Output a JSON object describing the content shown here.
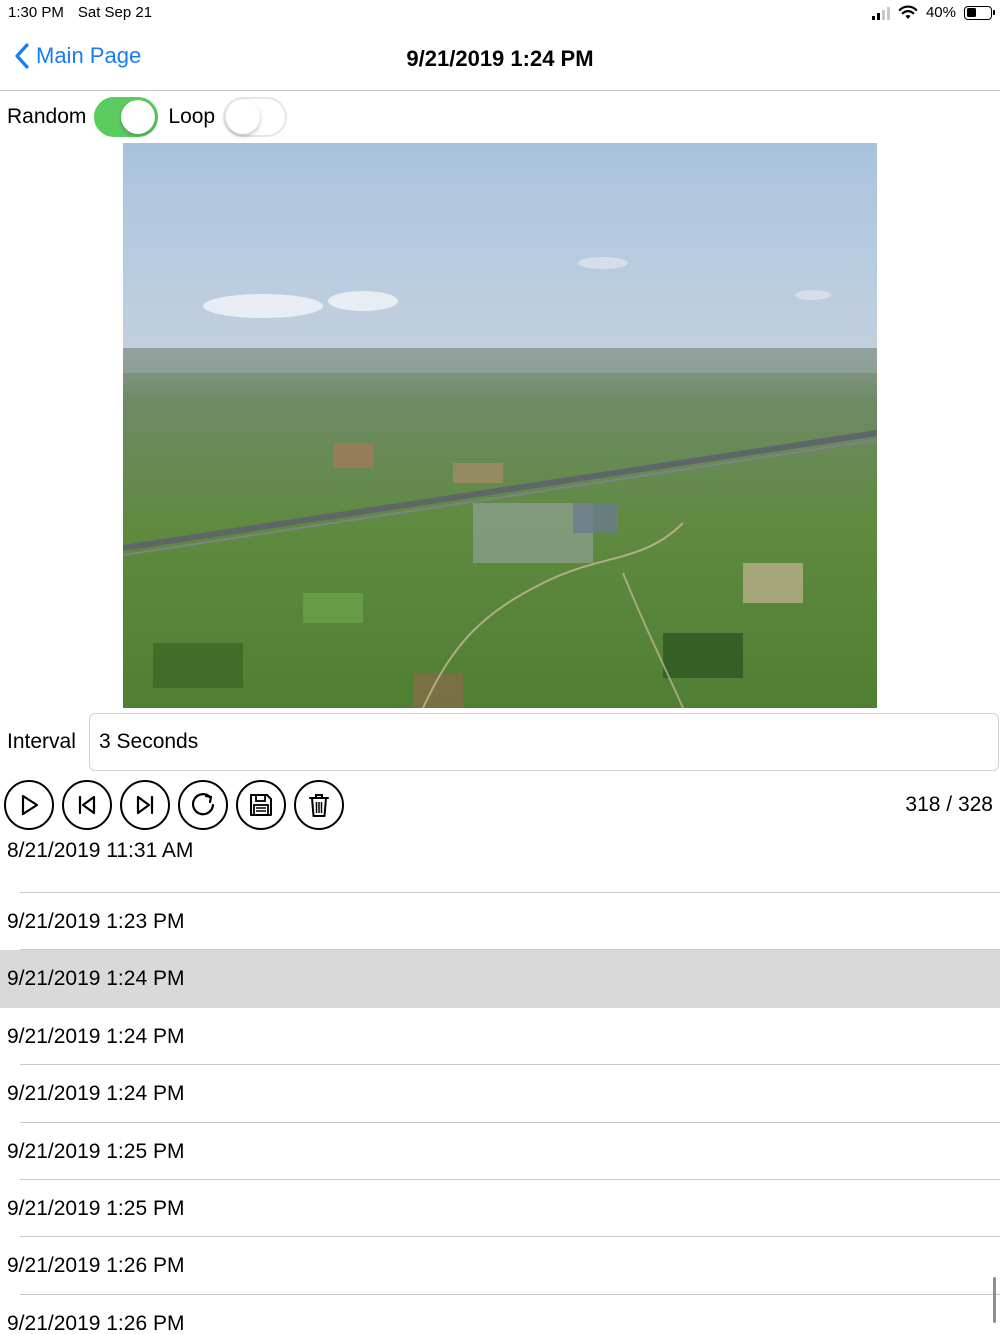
{
  "status_bar": {
    "time": "1:30 PM",
    "date": "Sat Sep 21",
    "battery": "40%",
    "battery_level": 0.4
  },
  "nav": {
    "back_label": "Main Page",
    "title": "9/21/2019 1:24 PM"
  },
  "toggles": {
    "random_label": "Random",
    "random_on": true,
    "loop_label": "Loop",
    "loop_on": false
  },
  "interval": {
    "label": "Interval",
    "value": "3 Seconds"
  },
  "controls": {
    "icons": [
      "play-icon",
      "skip-back-icon",
      "skip-forward-icon",
      "refresh-icon",
      "save-icon",
      "trash-icon"
    ],
    "counter": "318 / 328"
  },
  "list": {
    "items": [
      "8/21/2019 11:31 AM",
      "9/21/2019 1:23 PM",
      "9/21/2019 1:24 PM",
      "9/21/2019 1:24 PM",
      "9/21/2019 1:24 PM",
      "9/21/2019 1:25 PM",
      "9/21/2019 1:25 PM",
      "9/21/2019 1:26 PM",
      "9/21/2019 1:26 PM"
    ],
    "selected_index": 2
  },
  "colors": {
    "accent": "#1a7cf5",
    "switch_on": "#5ccb5f",
    "selected_row": "#d9d9d9"
  }
}
